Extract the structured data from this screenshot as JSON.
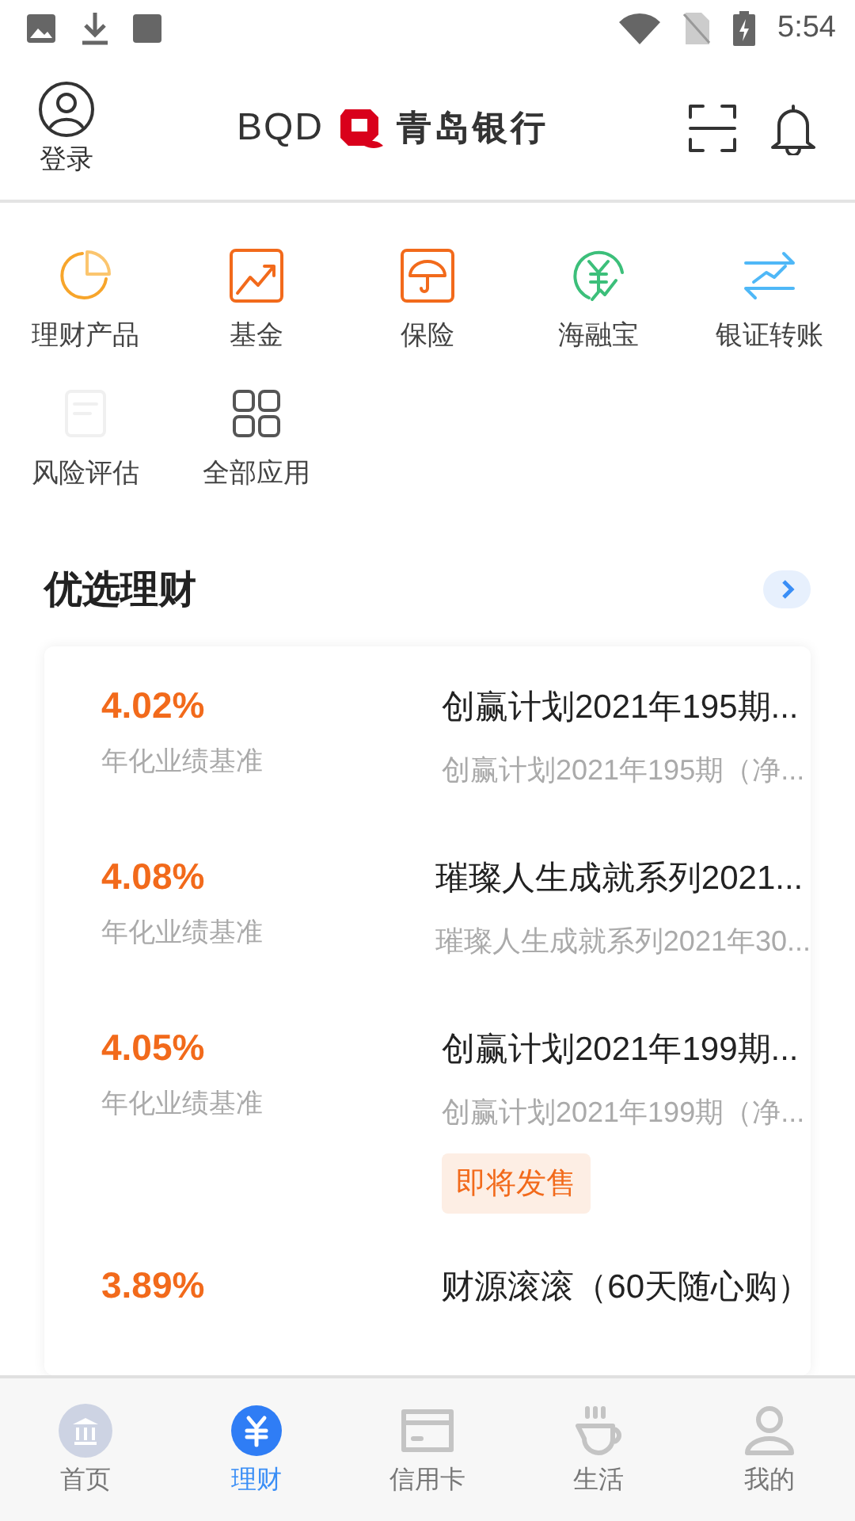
{
  "status_bar": {
    "time": "5:54"
  },
  "header": {
    "login": "登录",
    "logo_text": "BQD",
    "bank_name": "青岛银行"
  },
  "shortcuts": [
    {
      "label": "理财产品"
    },
    {
      "label": "基金"
    },
    {
      "label": "保险"
    },
    {
      "label": "海融宝"
    },
    {
      "label": "银证转账"
    },
    {
      "label": "风险评估"
    },
    {
      "label": "全部应用"
    }
  ],
  "section": {
    "title": "优选理财"
  },
  "products": [
    {
      "rate": "4.02%",
      "rate_label": "年化业绩基准",
      "title": "创赢计划2021年195期...",
      "subtitle": "创赢计划2021年195期（净..."
    },
    {
      "rate": "4.08%",
      "rate_label": "年化业绩基准",
      "title": "璀璨人生成就系列2021...",
      "subtitle": "璀璨人生成就系列2021年30..."
    },
    {
      "rate": "4.05%",
      "rate_label": "年化业绩基准",
      "title": "创赢计划2021年199期...",
      "subtitle": "创赢计划2021年199期（净...",
      "tag": "即将发售"
    },
    {
      "rate": "3.89%",
      "title": "财源滚滚（60天随心购）"
    }
  ],
  "tab_bar": [
    {
      "label": "首页",
      "selected": false
    },
    {
      "label": "理财",
      "selected": true
    },
    {
      "label": "信用卡",
      "selected": false
    },
    {
      "label": "生活",
      "selected": false
    },
    {
      "label": "我的",
      "selected": false
    }
  ]
}
